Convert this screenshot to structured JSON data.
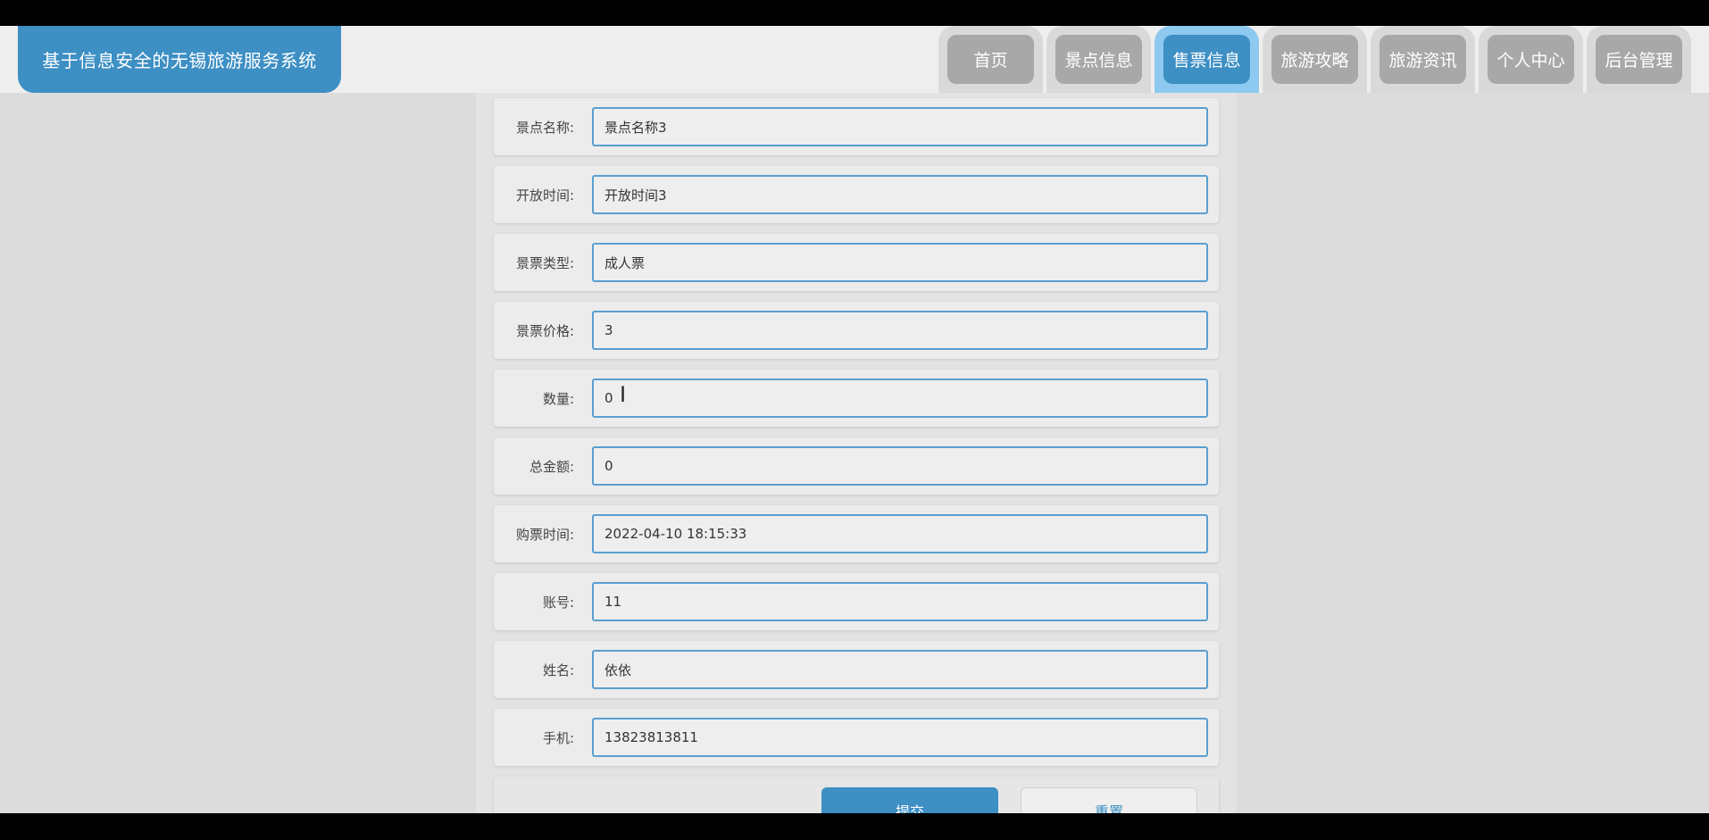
{
  "header": {
    "title": "基于信息安全的无锡旅游服务系统",
    "nav": [
      "首页",
      "景点信息",
      "售票信息",
      "旅游攻略",
      "旅游资讯",
      "个人中心",
      "后台管理"
    ],
    "active_nav": "售票信息"
  },
  "form": {
    "fields": [
      {
        "label": "景点名称:",
        "value": "景点名称3"
      },
      {
        "label": "开放时间:",
        "value": "开放时间3"
      },
      {
        "label": "景票类型:",
        "value": "成人票"
      },
      {
        "label": "景票价格:",
        "value": "3"
      },
      {
        "label": "数量:",
        "value": "0"
      },
      {
        "label": "总金额:",
        "value": "0"
      },
      {
        "label": "购票时间:",
        "value": "2022-04-10 18:15:33"
      },
      {
        "label": "账号:",
        "value": "11"
      },
      {
        "label": "姓名:",
        "value": "依依"
      },
      {
        "label": "手机:",
        "value": "13823813811"
      }
    ],
    "submit_label": "提交",
    "reset_label": "重置"
  },
  "colors": {
    "accent": "#3d8fc4",
    "nav_inactive": "#a8a8a8",
    "page_bg": "#dcdcdc"
  }
}
